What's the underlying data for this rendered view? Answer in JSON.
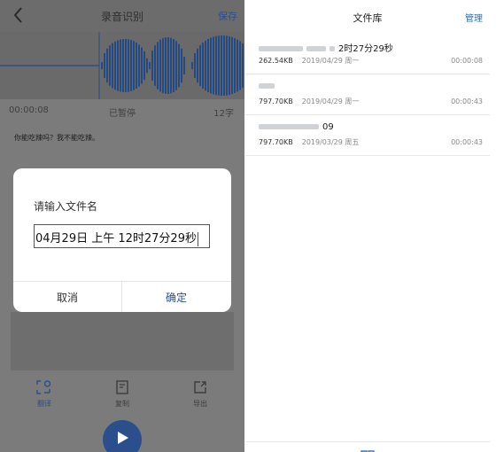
{
  "left": {
    "header": {
      "title": "录音识别",
      "save": "保存"
    },
    "status": {
      "time": "00:00:08",
      "state": "已暂停",
      "count": "12字"
    },
    "transcript": "你能吃辣吗？我不能吃辣。",
    "tools": [
      {
        "icon": "translate-icon",
        "label": "翻译"
      },
      {
        "icon": "copy-icon",
        "label": "复制"
      },
      {
        "icon": "export-icon",
        "label": "导出"
      }
    ],
    "play_icon": "play-icon",
    "dialog": {
      "title": "请输入文件名",
      "value": "04月29日 上午 12时27分29秒",
      "cancel": "取消",
      "confirm": "确定"
    },
    "colors": {
      "accent": "#2c4f8c",
      "overlay": "#7b7b7b"
    }
  },
  "right": {
    "header": {
      "title": "文件库",
      "manage": "管理"
    },
    "files": [
      {
        "name": "2时27分29秒",
        "size": "262.54KB",
        "date": "2019/04/29 周一",
        "duration": "00:00:08"
      },
      {
        "name": "",
        "size": "797.70KB",
        "date": "2019/04/29 周一",
        "duration": "00:00:43"
      },
      {
        "name": "09",
        "size": "797.70KB",
        "date": "2019/03/29 周五",
        "duration": "00:00:43"
      }
    ],
    "nav_icons": [
      "record-icon",
      "library-icon",
      "profile-icon"
    ],
    "colors": {
      "accent": "#2c6fb8"
    }
  }
}
